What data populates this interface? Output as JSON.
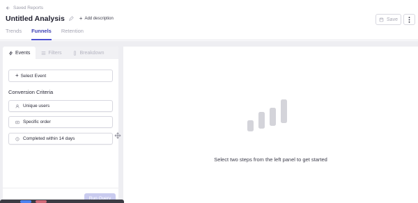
{
  "header": {
    "back_label": "Saved Reports",
    "title": "Untitled Analysis",
    "add_description_label": "Add description",
    "save_label": "Save",
    "tabs": [
      {
        "label": "Trends",
        "active": false
      },
      {
        "label": "Funnels",
        "active": true
      },
      {
        "label": "Retention",
        "active": false
      }
    ]
  },
  "left_panel": {
    "tabs": [
      {
        "label": "Events",
        "icon": "bolt-icon",
        "active": true
      },
      {
        "label": "Filters",
        "icon": "filter-icon",
        "active": false
      },
      {
        "label": "Breakdown",
        "icon": "breakdown-icon",
        "active": false
      }
    ],
    "select_event_label": "Select Event",
    "section_title": "Conversion Criteria",
    "criteria": [
      {
        "label": "Unique users",
        "icon": "user-icon"
      },
      {
        "label": "Specific order",
        "icon": "order-icon"
      },
      {
        "label": "Completed within 14 days",
        "icon": "clock-icon"
      }
    ],
    "run_query_label": "Run Query"
  },
  "right_panel": {
    "empty_state_text": "Select two steps from the left panel to get started",
    "icon": "bar-chart-icon"
  },
  "colors": {
    "accent": "#4b4fd1",
    "run_query_disabled": "#c9cbef",
    "background": "#eeeef2"
  }
}
